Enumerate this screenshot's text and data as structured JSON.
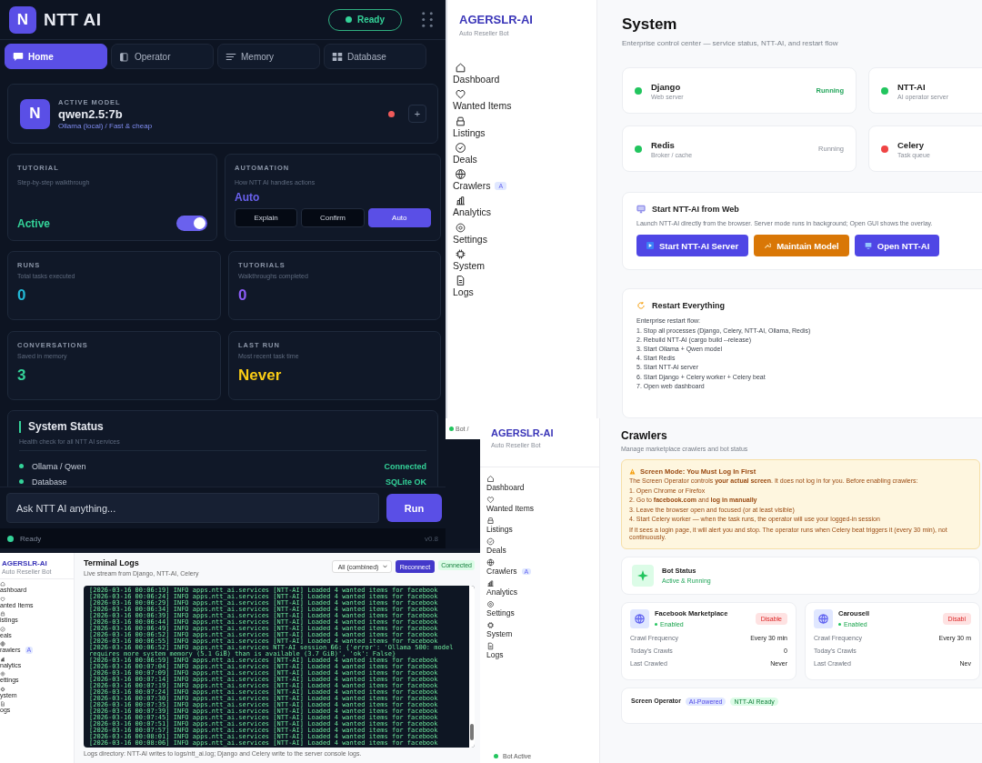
{
  "assistant_app": {
    "logo": "N",
    "title": "NTT AI",
    "status": "Ready",
    "tabs": [
      {
        "label": "Home",
        "selected": true
      },
      {
        "label": "Operator",
        "selected": false
      },
      {
        "label": "Memory",
        "selected": false
      },
      {
        "label": "Database",
        "selected": false
      }
    ],
    "active_model": {
      "caption": "ACTIVE MODEL",
      "logo": "N",
      "name": "qwen2.5:7b",
      "provider": "Ollama (local) / Fast & cheap",
      "online": false,
      "add": "+"
    },
    "tutorial": {
      "caption": "TUTORIAL",
      "hint": "Step-by-step walkthrough",
      "value": "Active",
      "on": true
    },
    "automation": {
      "caption": "AUTOMATION",
      "hint": "How NTT AI handles actions",
      "value": "Auto",
      "modes": [
        {
          "label": "Explain",
          "selected": false
        },
        {
          "label": "Confirm",
          "selected": false
        },
        {
          "label": "Auto",
          "selected": true
        }
      ]
    },
    "stats": [
      {
        "caption": "RUNS",
        "hint": "Total tasks executed",
        "value": "0",
        "color": "#22b8d6"
      },
      {
        "caption": "TUTORIALS",
        "hint": "Walkthroughs completed",
        "value": "0",
        "color": "#8b5cf6"
      },
      {
        "caption": "CONVERSATIONS",
        "hint": "Saved in memory",
        "value": "3",
        "color": "#34d399"
      },
      {
        "caption": "LAST RUN",
        "hint": "Most recent task time",
        "value": "Never",
        "color": "#facc15"
      }
    ],
    "system_status": {
      "title": "System Status",
      "hint": "Health check for all NTT AI services",
      "services": [
        {
          "name": "Ollama / Qwen",
          "status": "Connected",
          "ok": true
        },
        {
          "name": "Database",
          "status": "SQLite OK",
          "ok": true
        }
      ]
    },
    "prompt": {
      "placeholder": "Ask NTT AI anything...",
      "button": "Run"
    },
    "status_bar": {
      "text": "Ready",
      "version": "v0.8"
    }
  },
  "system_page": {
    "brand": "AGERSLR-AI",
    "tagline": "Auto Reseller Bot",
    "nav": [
      {
        "label": "Dashboard"
      },
      {
        "label": "Wanted Items"
      },
      {
        "label": "Listings"
      },
      {
        "label": "Deals"
      },
      {
        "label": "Crawlers",
        "badge": "A"
      },
      {
        "label": "Analytics"
      },
      {
        "label": "Settings"
      },
      {
        "label": "System"
      },
      {
        "label": "Logs"
      }
    ],
    "title": "System",
    "subtitle": "Enterprise control center — service status, NTT-AI, and restart flow",
    "services": [
      {
        "name": "Django",
        "desc": "Web server",
        "status": "Running",
        "highlight": true,
        "color": "#22c55e"
      },
      {
        "name": "NTT-AI",
        "desc": "AI operator server",
        "color": "#22c55e"
      },
      {
        "name": "Redis",
        "desc": "Broker / cache",
        "status": "Running",
        "highlight": false,
        "color": "#22c55e"
      },
      {
        "name": "Celery",
        "desc": "Task queue",
        "color": "#ef4444"
      }
    ],
    "start": {
      "title": "Start NTT-AI from Web",
      "desc": "Launch NTT-AI directly from the browser. Server mode runs in background; Open GUI shows the overlay.",
      "buttons": [
        {
          "label": "Start NTT-AI Server",
          "kind": "primary"
        },
        {
          "label": "Maintain Model",
          "kind": "warning"
        },
        {
          "label": "Open NTT-AI",
          "kind": "primary"
        }
      ]
    },
    "restart": {
      "title": "Restart Everything",
      "intro": "Enterprise restart flow:",
      "steps": [
        "1. Stop all processes (Django, Celery, NTT-AI, Ollama, Redis)",
        "2. Rebuild NTT-AI (cargo build --release)",
        "3. Start Ollama + Qwen model",
        "4. Start Redis",
        "5. Start NTT-AI server",
        "6. Start Django + Celery worker + Celery beat",
        "7. Open web dashboard"
      ]
    }
  },
  "side_strip": {
    "text": "Bot /"
  },
  "crawlers_page": {
    "brand": "AGERSLR-AI",
    "tagline": "Auto Reseller Bot",
    "nav": [
      {
        "label": "Dashboard"
      },
      {
        "label": "Wanted Items"
      },
      {
        "label": "Listings"
      },
      {
        "label": "Deals"
      },
      {
        "label": "Crawlers",
        "badge": "A"
      },
      {
        "label": "Analytics"
      },
      {
        "label": "Settings"
      },
      {
        "label": "System"
      },
      {
        "label": "Logs"
      }
    ],
    "footer": "Bot Active",
    "title": "Crawlers",
    "subtitle": "Manage marketplace crawlers and bot status",
    "notice": {
      "title": "Screen Mode: You Must Log In First",
      "body": "The Screen Operator controls **your actual screen**. It does not log in for you. Before enabling crawlers:",
      "steps": [
        "1. Open Chrome or Firefox",
        "2. Go to **facebook.com** and **log in manually**",
        "3. Leave the browser open and focused (or at least visible)",
        "4. Start Celery worker — when the task runs, the operator will use your logged-in session"
      ],
      "note": "If it sees a login page, it will alert you and stop. The operator runs when Celery beat triggers it (every 30 min), not continuously."
    },
    "bot_status": {
      "title": "Bot Status",
      "state": "Active & Running"
    },
    "crawlers": [
      {
        "name": "Facebook Marketplace",
        "status": "Enabled",
        "enabled": true,
        "action": "Disable",
        "rows": [
          {
            "label": "Crawl Frequency",
            "value": "Every 30 min"
          },
          {
            "label": "Today's Crawls",
            "value": "0"
          },
          {
            "label": "Last Crawled",
            "value": "Never"
          }
        ]
      },
      {
        "name": "Carousell",
        "status": "Enabled",
        "enabled": true,
        "action": "Disabl",
        "rows": [
          {
            "label": "Crawl Frequency",
            "value": "Every 30 m"
          },
          {
            "label": "Today's Crawls"
          },
          {
            "label": "Last Crawled",
            "value": "Nev"
          }
        ]
      }
    ],
    "operator": {
      "title": "Screen Operator",
      "badges": [
        "AI-Powered",
        "NTT-AI Ready"
      ]
    }
  },
  "logs_page": {
    "brand": "AGERSLR-AI",
    "tagline": "Auto Reseller Bot",
    "nav": [
      {
        "label": "ashboard"
      },
      {
        "label": "anted Items"
      },
      {
        "label": "istings"
      },
      {
        "label": "eals"
      },
      {
        "label": "rawlers",
        "badge": "A"
      },
      {
        "label": "nalytics"
      },
      {
        "label": "ettings"
      },
      {
        "label": "ystem"
      },
      {
        "label": "ogs"
      }
    ],
    "title": "Terminal Logs",
    "subtitle": "Live stream from Django, NTT-AI, Celery",
    "source": "All (combined)",
    "button": "Reconnect",
    "connection": "Connected",
    "lines": [
      "[2026-03-16 00:06:19] INFO apps.ntt_ai.services [NTT-AI] Loaded 4 wanted items for facebook",
      "[2026-03-16 00:06:24] INFO apps.ntt_ai.services [NTT-AI] Loaded 4 wanted items for facebook",
      "[2026-03-16 00:06:29] INFO apps.ntt_ai.services [NTT-AI] Loaded 4 wanted items for facebook",
      "[2026-03-16 00:06:34] INFO apps.ntt_ai.services [NTT-AI] Loaded 4 wanted items for facebook",
      "[2026-03-16 00:06:39] INFO apps.ntt_ai.services [NTT-AI] Loaded 4 wanted items for facebook",
      "[2026-03-16 00:06:44] INFO apps.ntt_ai.services [NTT-AI] Loaded 4 wanted items for facebook",
      "[2026-03-16 00:06:49] INFO apps.ntt_ai.services [NTT-AI] Loaded 4 wanted items for facebook",
      "[2026-03-16 00:06:52] INFO apps.ntt_ai.services [NTT-AI] Loaded 4 wanted items for facebook",
      "[2026-03-16 00:06:55] INFO apps.ntt_ai.services [NTT-AI] Loaded 4 wanted items for facebook",
      "[2026-03-16 00:06:52] INFO apps.ntt_ai.services NTT-AI session 66: {'error': 'Ollama 500: model requires more system memory (5.1 GiB) than is available (3.7 GiB)', 'ok': False}",
      "[2026-03-16 00:06:59] INFO apps.ntt_ai.services [NTT-AI] Loaded 4 wanted items for facebook",
      "[2026-03-16 00:07:04] INFO apps.ntt_ai.services [NTT-AI] Loaded 4 wanted items for facebook",
      "[2026-03-16 00:07:09] INFO apps.ntt_ai.services [NTT-AI] Loaded 4 wanted items for facebook",
      "[2026-03-16 00:07:14] INFO apps.ntt_ai.services [NTT-AI] Loaded 4 wanted items for facebook",
      "[2026-03-16 00:07:19] INFO apps.ntt_ai.services [NTT-AI] Loaded 4 wanted items for facebook",
      "[2026-03-16 00:07:24] INFO apps.ntt_ai.services [NTT-AI] Loaded 4 wanted items for facebook",
      "[2026-03-16 00:07:30] INFO apps.ntt_ai.services [NTT-AI] Loaded 4 wanted items for facebook",
      "[2026-03-16 00:07:35] INFO apps.ntt_ai.services [NTT-AI] Loaded 4 wanted items for facebook",
      "[2026-03-16 00:07:39] INFO apps.ntt_ai.services [NTT-AI] Loaded 4 wanted items for facebook",
      "[2026-03-16 00:07:45] INFO apps.ntt_ai.services [NTT-AI] Loaded 4 wanted items for facebook",
      "[2026-03-16 00:07:51] INFO apps.ntt_ai.services [NTT-AI] Loaded 4 wanted items for facebook",
      "[2026-03-16 00:07:57] INFO apps.ntt_ai.services [NTT-AI] Loaded 4 wanted items for facebook",
      "[2026-03-16 00:08:01] INFO apps.ntt_ai.services [NTT-AI] Loaded 4 wanted items for facebook",
      "[2026-03-16 00:08:06] INFO apps.ntt_ai.services [NTT-AI] Loaded 4 wanted items for facebook"
    ],
    "footer": "Logs directory: NTT-AI writes to logs/ntt_ai.log; Django and Celery write to the server console logs."
  }
}
